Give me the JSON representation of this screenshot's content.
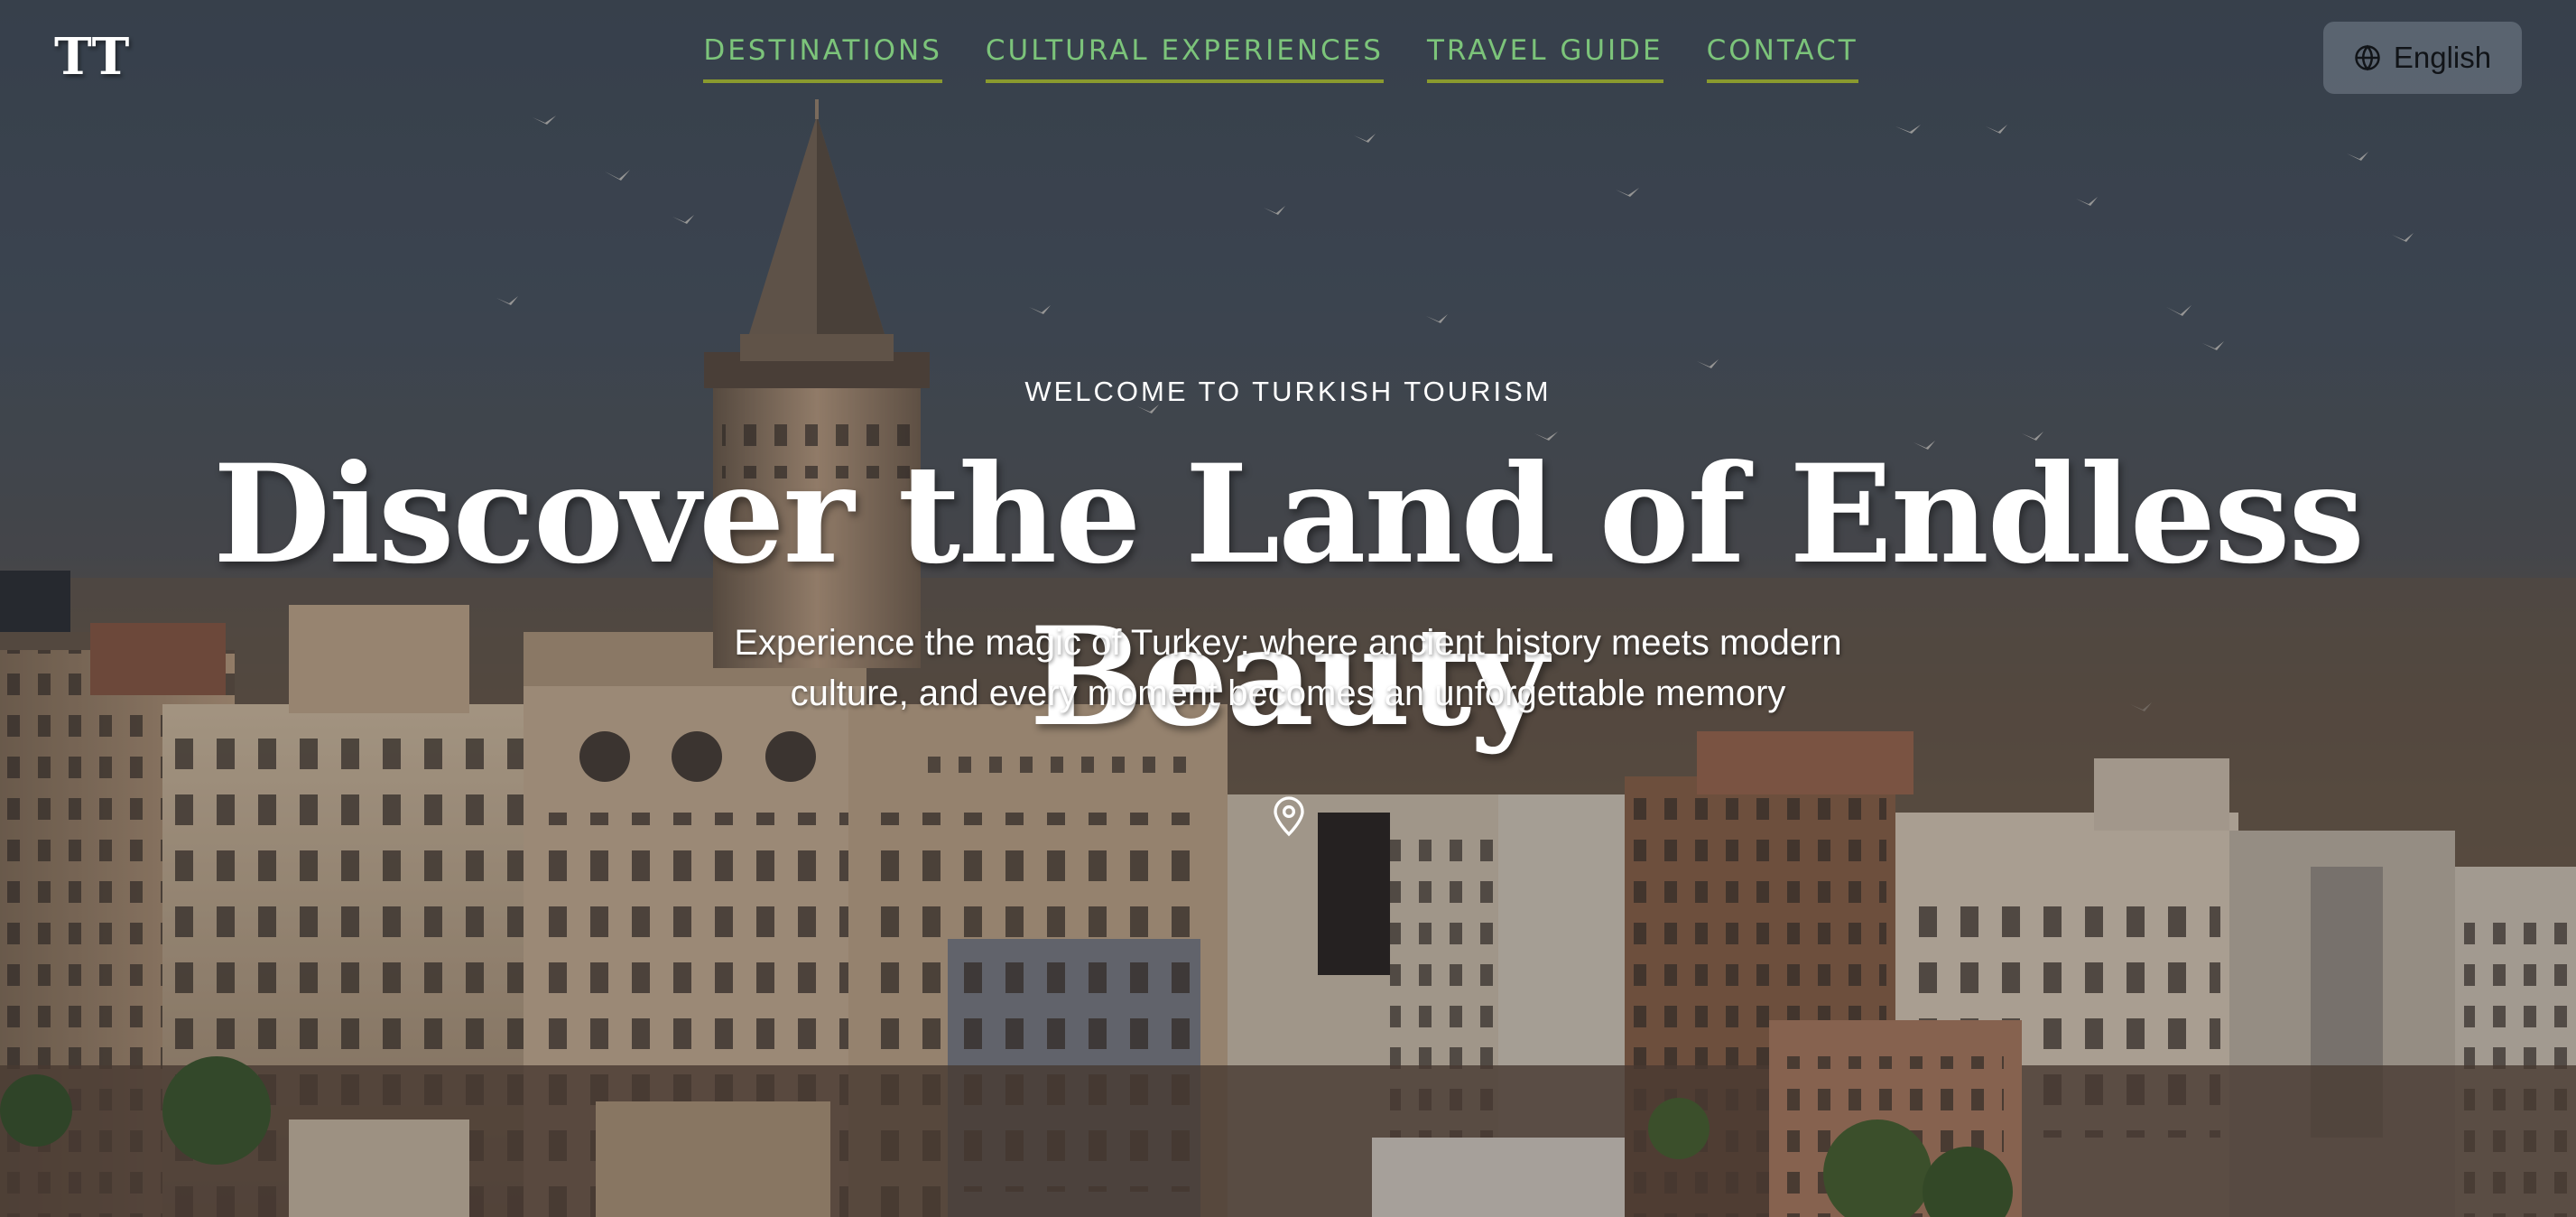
{
  "header": {
    "logo": "TT",
    "nav": [
      {
        "label": "DESTINATIONS"
      },
      {
        "label": "CULTURAL EXPERIENCES"
      },
      {
        "label": "TRAVEL GUIDE"
      },
      {
        "label": "CONTACT"
      }
    ],
    "language": {
      "icon": "globe-icon",
      "label": "English"
    }
  },
  "hero": {
    "eyebrow": "WELCOME TO TURKISH TOURISM",
    "title": "Discover the Land of Endless Beauty",
    "subtitle_line1": "Experience the magic of Turkey: where ancient history meets modern",
    "subtitle_line2": "culture, and every moment becomes an unforgettable memory",
    "scroll_icon": "map-pin-icon",
    "background_image": "galata-tower-istanbul-skyline"
  },
  "colors": {
    "nav_text": "#7cc47a",
    "nav_underline": "#8a9a2e",
    "hero_text": "#ffffff",
    "language_button_bg": "#78828e",
    "language_text": "#111418"
  }
}
